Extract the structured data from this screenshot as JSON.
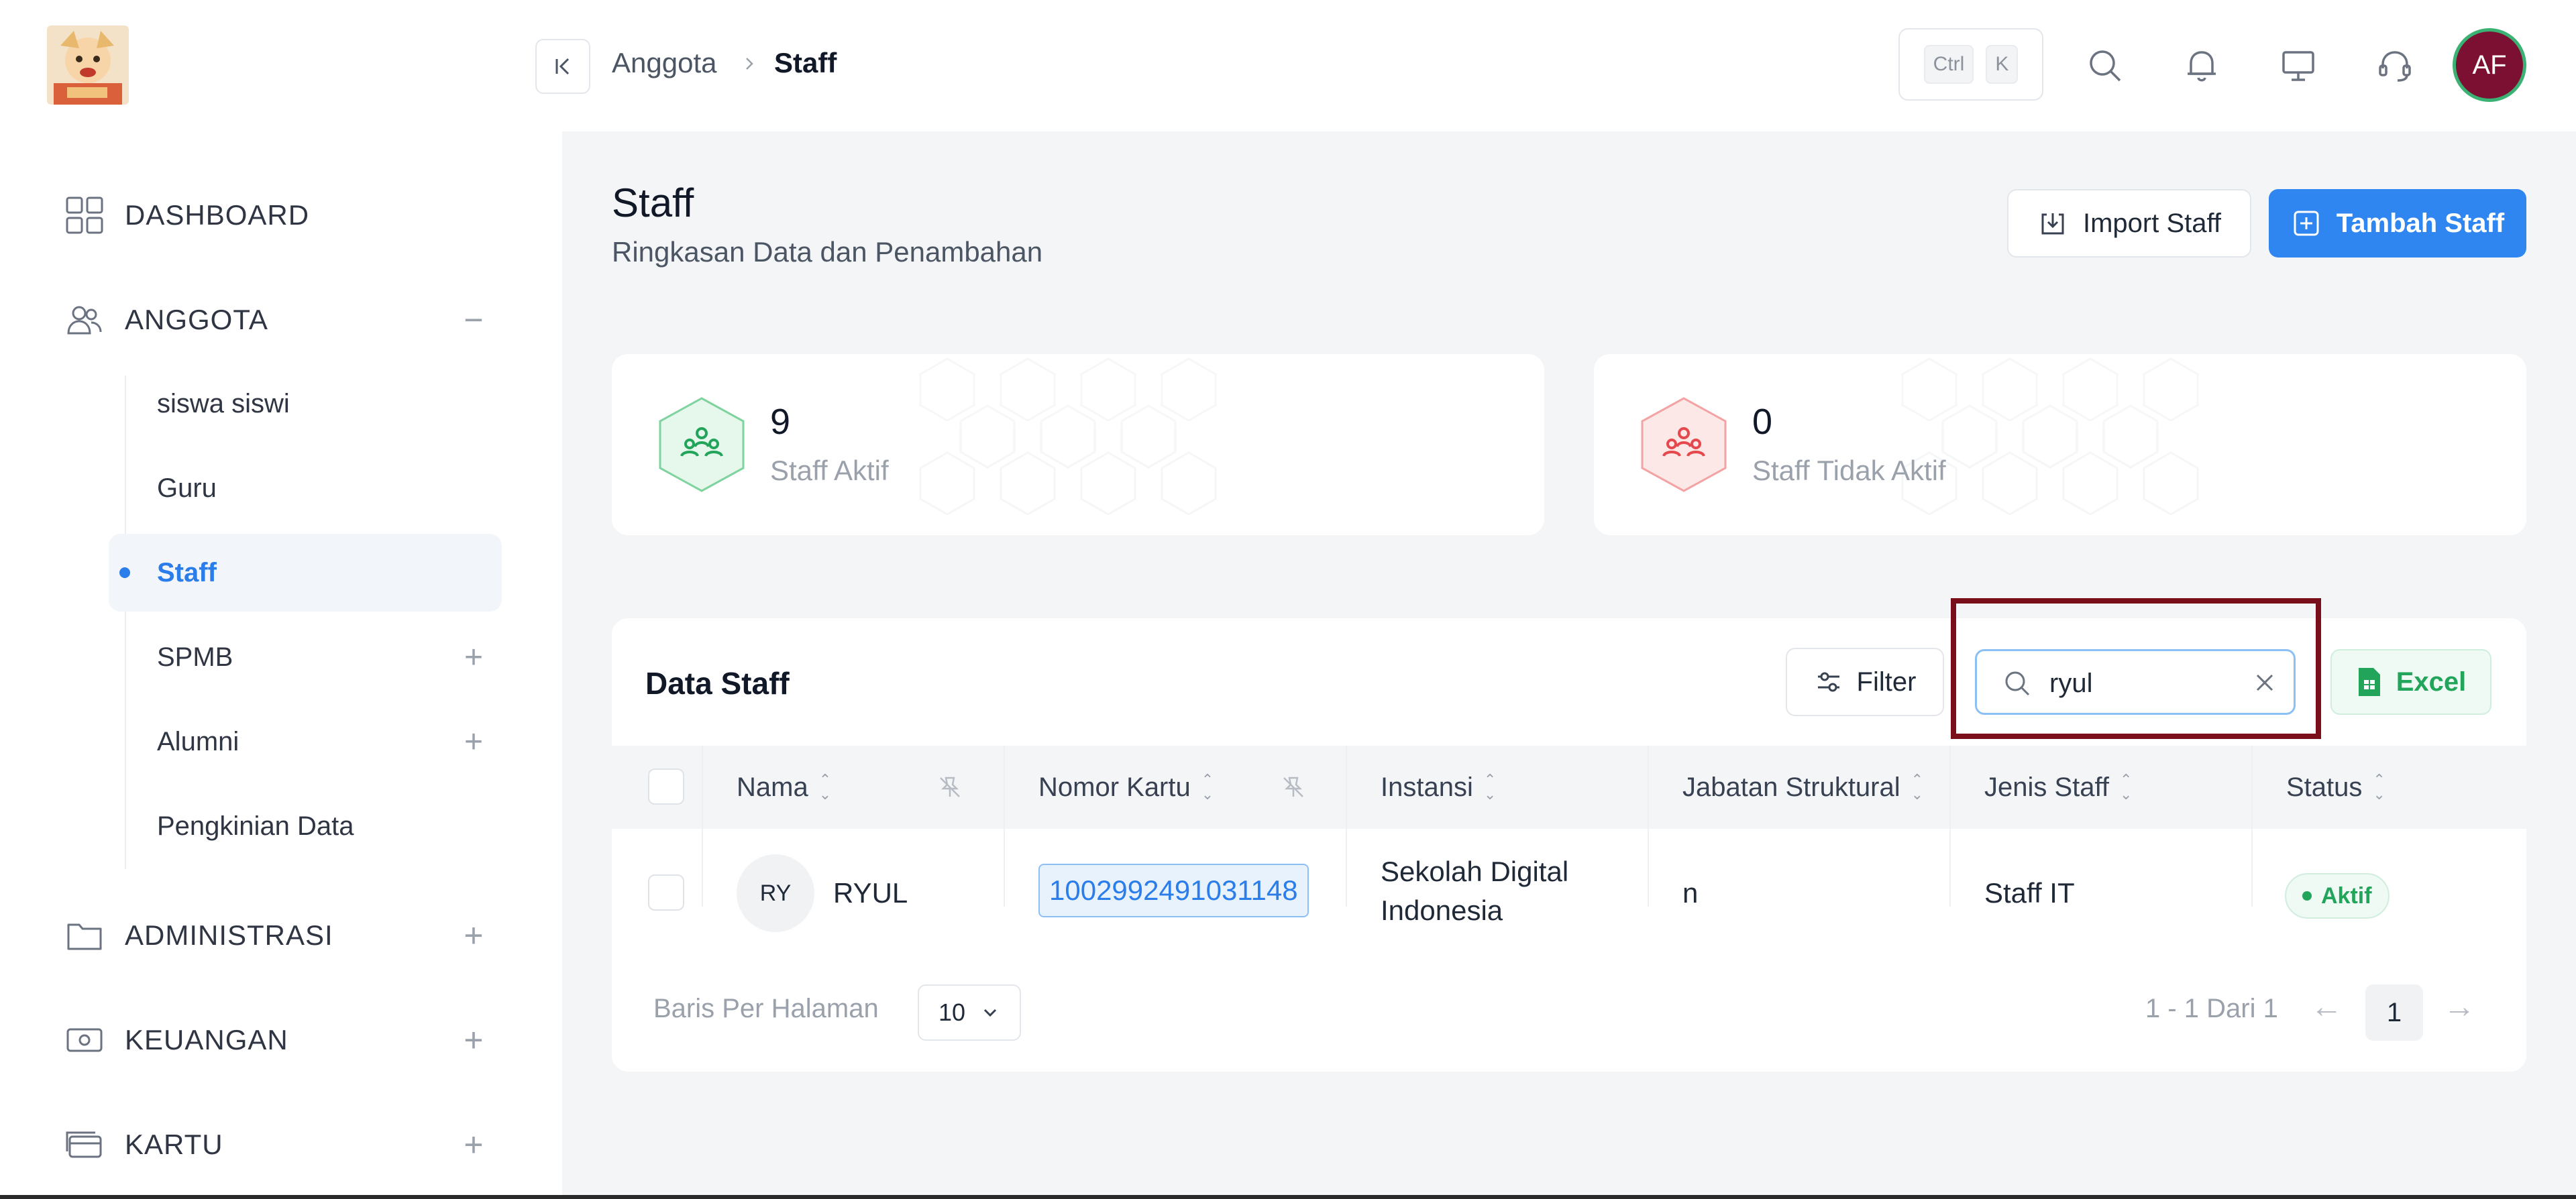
{
  "sidebar": {
    "sections": [
      {
        "label": "DASHBOARD",
        "icon": "dashboard-icon",
        "toggle": ""
      },
      {
        "label": "ANGGOTA",
        "icon": "users-icon",
        "toggle": "−"
      },
      {
        "label": "ADMINISTRASI",
        "icon": "folder-icon",
        "toggle": "+"
      },
      {
        "label": "KEUANGAN",
        "icon": "money-icon",
        "toggle": "+"
      },
      {
        "label": "KARTU",
        "icon": "card-icon",
        "toggle": "+"
      }
    ],
    "sub_items": [
      {
        "label": "siswa siswi",
        "toggle": ""
      },
      {
        "label": "Guru",
        "toggle": ""
      },
      {
        "label": "Staff",
        "toggle": "",
        "active": true
      },
      {
        "label": "SPMB",
        "toggle": "+"
      },
      {
        "label": "Alumni",
        "toggle": "+"
      },
      {
        "label": "Pengkinian Data",
        "toggle": ""
      }
    ]
  },
  "header": {
    "breadcrumb": [
      "Anggota",
      "Staff"
    ],
    "shortcut": [
      "Ctrl",
      "K"
    ],
    "avatar": "AF"
  },
  "page": {
    "title": "Staff",
    "subtitle": "Ringkasan Data dan Penambahan",
    "import_label": "Import Staff",
    "add_label": "Tambah Staff"
  },
  "stats": [
    {
      "value": "9",
      "label": "Staff Aktif",
      "color": "#22a55a"
    },
    {
      "value": "0",
      "label": "Staff Tidak Aktif",
      "color": "#e5484d"
    }
  ],
  "table": {
    "title": "Data Staff",
    "filter_label": "Filter",
    "search_value": "ryul",
    "excel_label": "Excel",
    "columns": [
      "Nama",
      "Nomor Kartu",
      "Instansi",
      "Jabatan Struktural",
      "Jenis Staff",
      "Status"
    ],
    "rows": [
      {
        "initials": "RY",
        "name": "RYUL",
        "card_number": "100299249103114​8",
        "instansi_line1": "Sekolah Digital",
        "instansi_line2": "Indonesia",
        "jabatan": "n",
        "jenis": "Staff IT",
        "status": "Aktif"
      }
    ],
    "rows_per_page_label": "Baris Per Halaman",
    "rows_per_page": "10",
    "page_info": "1 - 1 Dari 1",
    "current_page": "1"
  }
}
